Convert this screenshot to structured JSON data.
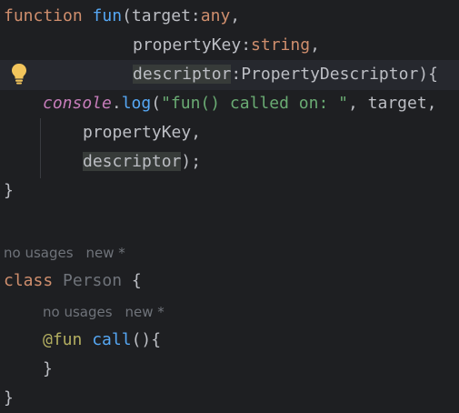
{
  "code": {
    "l1": {
      "kw": "function",
      "fn": "fun",
      "p1": "(target:",
      "t1": "any",
      "c1": ","
    },
    "l2": {
      "p": "propertyKey:",
      "t": "string",
      "c": ","
    },
    "l3": {
      "p": "descriptor",
      "rest": ":PropertyDescriptor){"
    },
    "l4": {
      "con": "console",
      "dot": ".",
      "meth": "log",
      "open": "(",
      "str": "\"fun() called on: \"",
      "rest": ", target,"
    },
    "l5": {
      "text": "propertyKey,"
    },
    "l6": {
      "p": "descriptor",
      "rest": ");"
    },
    "l7": {
      "text": "}"
    },
    "l10": {
      "kw": "class",
      "cls": "Person",
      "brace": "{"
    },
    "l12": {
      "ann": "@fun",
      "meth": "call",
      "rest": "(){"
    },
    "l13": {
      "text": "}"
    },
    "l14": {
      "text": "}"
    }
  },
  "hints": {
    "class_hint": {
      "usages": "no usages",
      "author": "new *"
    },
    "method_hint": {
      "usages": "no usages",
      "author": "new *"
    }
  },
  "gutter": {
    "intention_icon": "lightbulb-icon"
  }
}
